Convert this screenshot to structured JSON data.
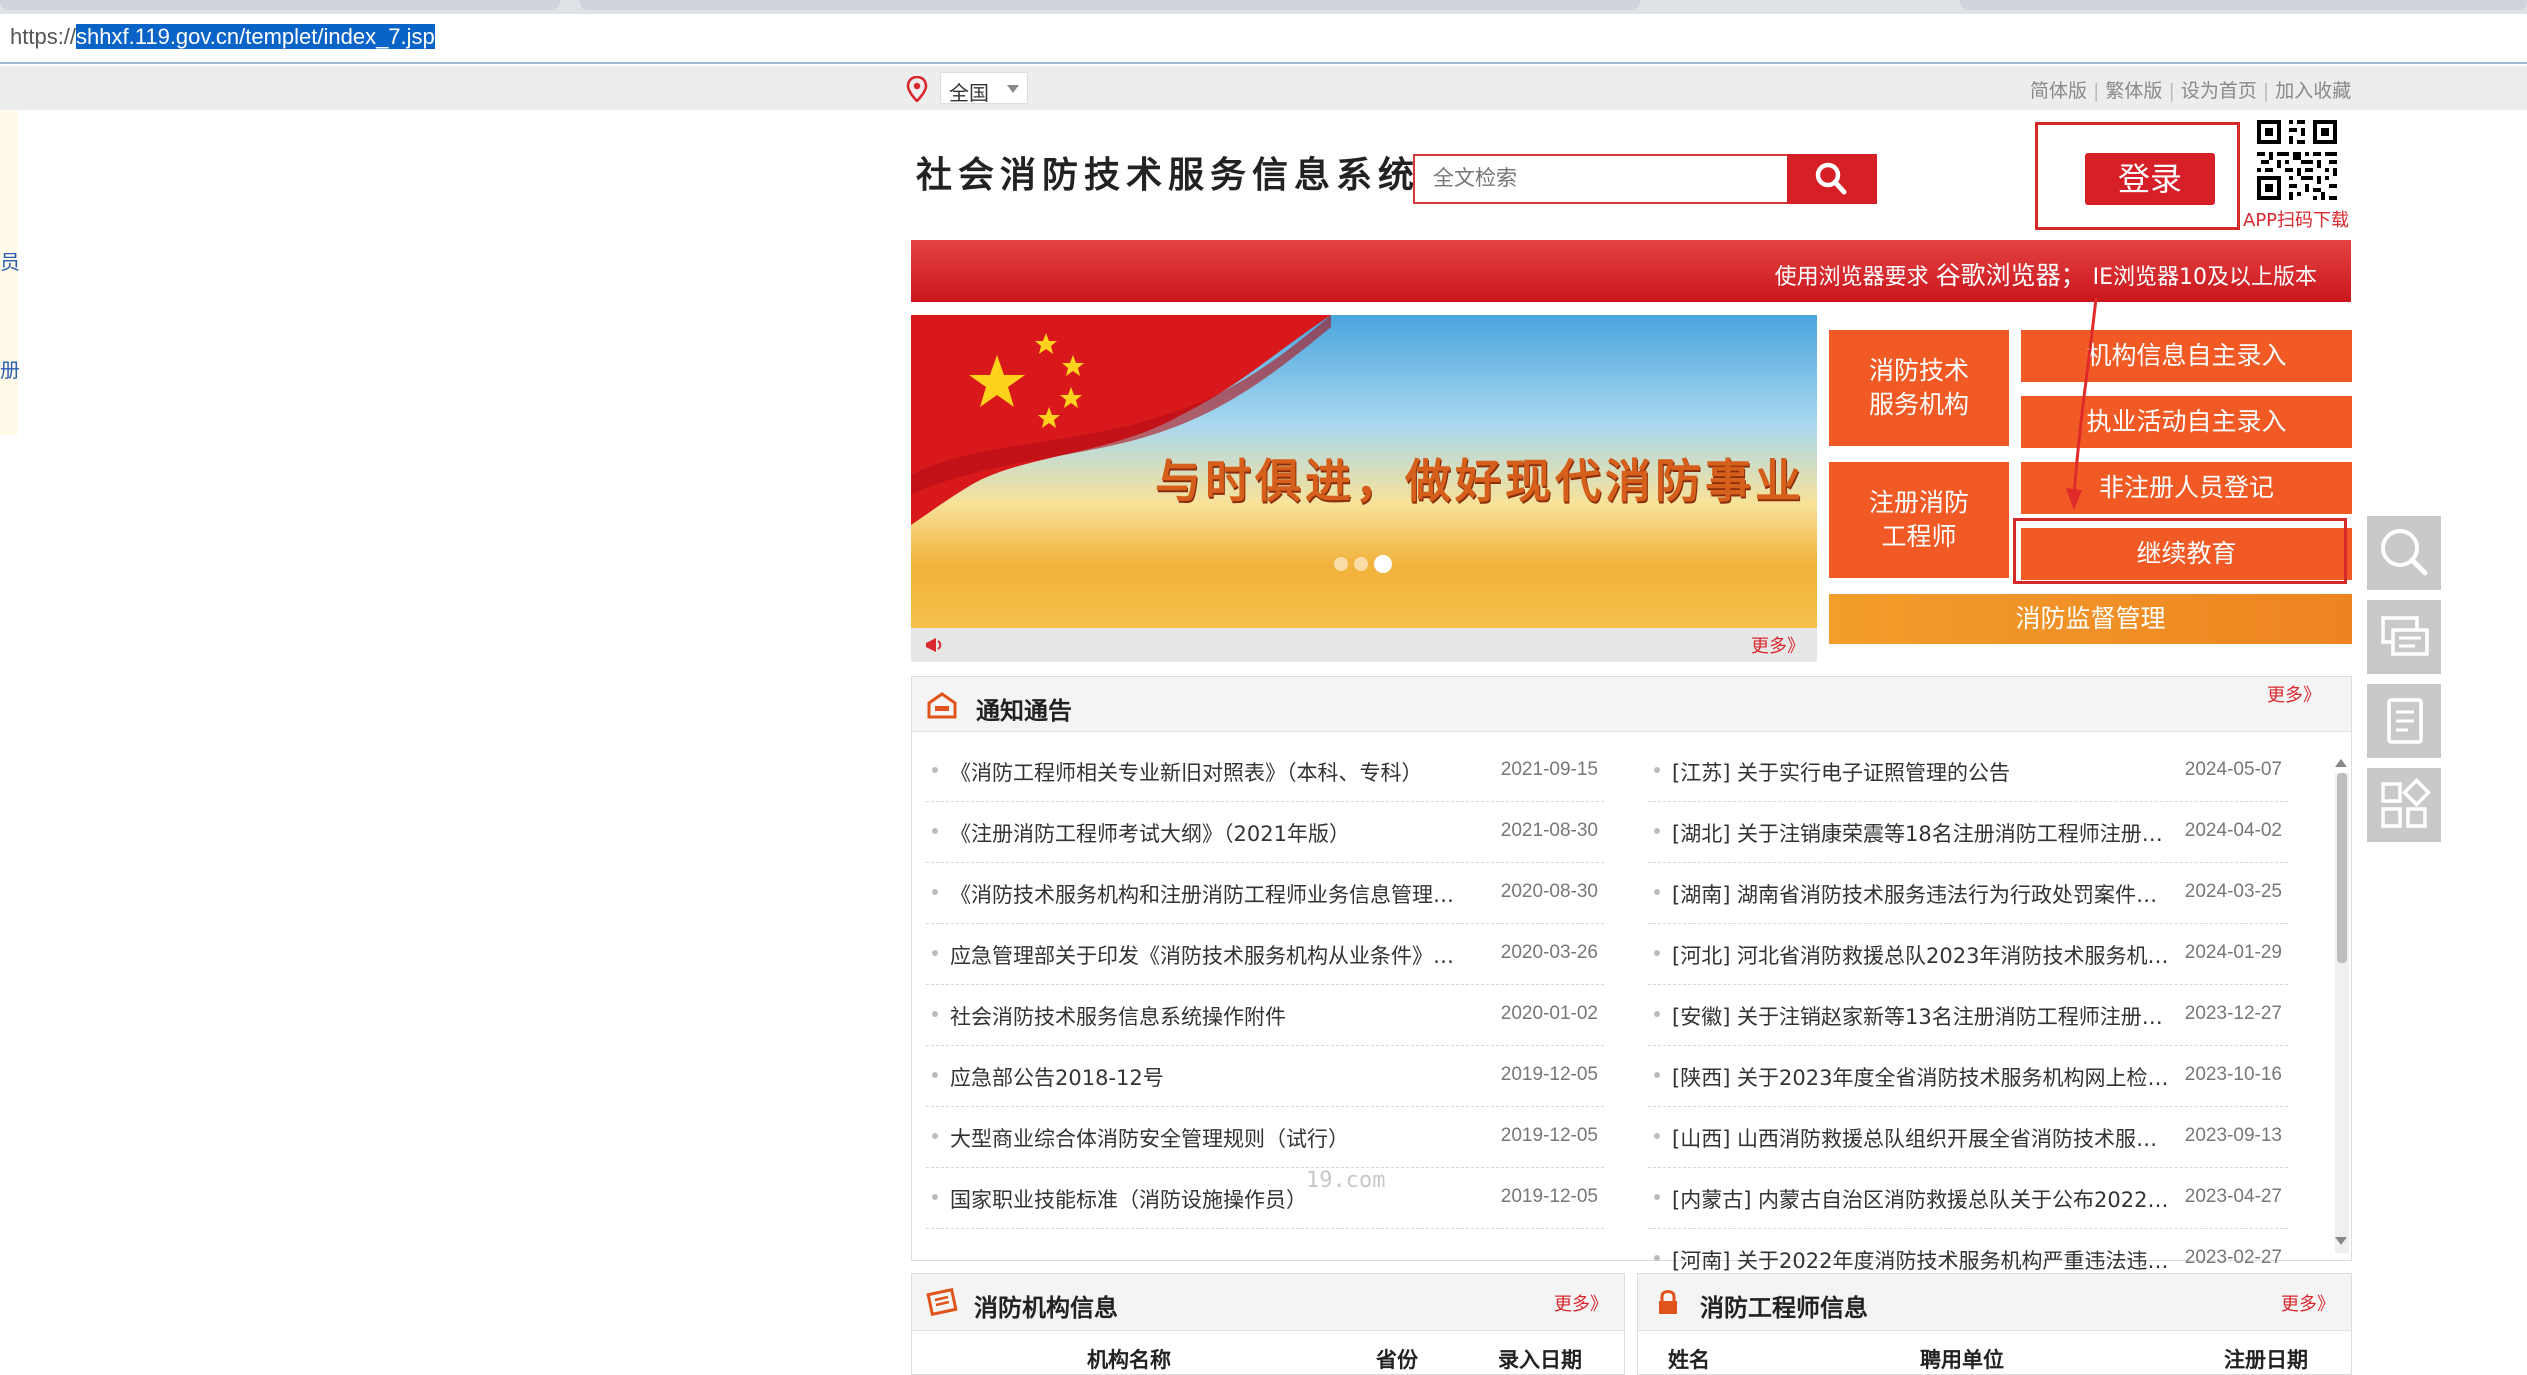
{
  "browser": {
    "url_prefix": "https://",
    "url_selected": "shhxf.119.gov.cn/templet/index_7.jsp"
  },
  "topbar": {
    "region": "全国",
    "links": [
      "简体版",
      "繁体版",
      "设为首页",
      "加入收藏"
    ],
    "separator": "|"
  },
  "left_sidebar": {
    "item_a": "员",
    "item_b": "册"
  },
  "header": {
    "title": "社会消防技术服务信息系统",
    "search_placeholder": "全文检索",
    "login_label": "登录",
    "qr_label": "APP扫码下载"
  },
  "notice_bar": {
    "prefix": "使用浏览器要求",
    "browser": "谷歌浏览器；",
    "suffix": "IE浏览器10及以上版本"
  },
  "banner": {
    "slogan": "与时俱进，做好现代消防事业",
    "more": "更多》",
    "slides": 3,
    "active_slide": 3
  },
  "quick_buttons": {
    "org": "消防技术服务机构",
    "engineer": "注册消防工程师",
    "r1": "机构信息自主录入",
    "r2": "执业活动自主录入",
    "r3": "非注册人员登记",
    "r4": "继续教育",
    "supervise": "消防监督管理"
  },
  "side_tools": [
    "search-icon",
    "chat-icon",
    "notes-icon",
    "apps-icon"
  ],
  "notices": {
    "title": "通知通告",
    "more": "更多》",
    "watermark": "19.com",
    "left": [
      {
        "title": "《消防工程师相关专业新旧对照表》（本科、专科）",
        "date": "2021-09-15"
      },
      {
        "title": "《注册消防工程师考试大纲》（2021年版）",
        "date": "2021-08-30"
      },
      {
        "title": "《消防技术服务机构和注册消防工程师业务信息管理系...",
        "date": "2020-08-30"
      },
      {
        "title": "应急管理部关于印发《消防技术服务机构从业条件》的...",
        "date": "2020-03-26"
      },
      {
        "title": "社会消防技术服务信息系统操作附件",
        "date": "2020-01-02"
      },
      {
        "title": "应急部公告2018-12号",
        "date": "2019-12-05"
      },
      {
        "title": "大型商业综合体消防安全管理规则（试行）",
        "date": "2019-12-05"
      },
      {
        "title": "国家职业技能标准（消防设施操作员）",
        "date": "2019-12-05"
      }
    ],
    "right": [
      {
        "title": "[江苏]  关于实行电子证照管理的公告",
        "date": "2024-05-07"
      },
      {
        "title": "[湖北]  关于注销康荣震等18名注册消防工程师注册证...",
        "date": "2024-04-02"
      },
      {
        "title": "[湖南]  湖南省消防技术服务违法行为行政处罚案件公布...",
        "date": "2024-03-25"
      },
      {
        "title": "[河北]  河北省消防救援总队2023年消防技术服务机构...",
        "date": "2024-01-29"
      },
      {
        "title": "[安徽]  关于注销赵家新等13名注册消防工程师注册证...",
        "date": "2023-12-27"
      },
      {
        "title": "[陕西]  关于2023年度全省消防技术服务机构网上检查...",
        "date": "2023-10-16"
      },
      {
        "title": "[山西]  山西消防救援总队组织开展全省消防技术服务专...",
        "date": "2023-09-13"
      },
      {
        "title": "[内蒙古]  内蒙古自治区消防救援总队关于公布2022年...",
        "date": "2023-04-27"
      },
      {
        "title": "[河南]  关于2022年度消防技术服务机构严重违法违规...",
        "date": "2023-02-27"
      }
    ]
  },
  "org_info": {
    "title": "消防机构信息",
    "more": "更多》",
    "columns": [
      "机构名称",
      "省份",
      "录入日期"
    ]
  },
  "eng_info": {
    "title": "消防工程师信息",
    "more": "更多》",
    "columns": [
      "姓名",
      "聘用单位",
      "注册日期"
    ]
  },
  "colors": {
    "brand_red": "#d61f26",
    "action_orange": "#f15a24",
    "link_red": "#d9272e"
  }
}
